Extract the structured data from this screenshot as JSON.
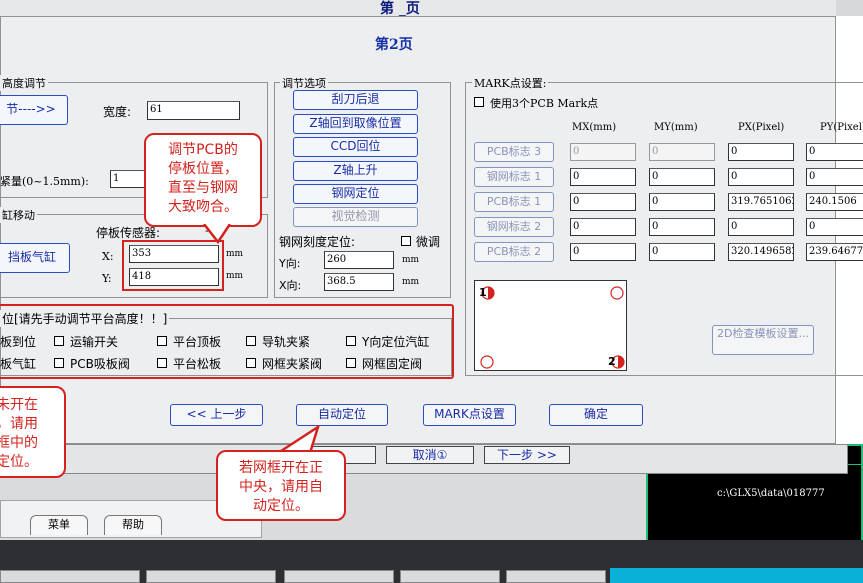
{
  "background": {
    "title_behind": "第 _页",
    "dialog_buttons": [
      "⊗",
      "取消①",
      "下一步 >>"
    ],
    "tabs": [
      "菜单",
      "帮助"
    ],
    "path_text": "c:\\GLX5\\data\\018777"
  },
  "dialog": {
    "title": "第2页",
    "height_group": {
      "label": "高度调节",
      "button_label": "节---->>",
      "width_label": "宽度:",
      "width_value": "61",
      "squeeze_label": "紧量(0~1.5mm):",
      "squeeze_value": "1"
    },
    "cylinder_group": {
      "label": "缸移动",
      "sensor_label": "停板传感器:",
      "sensor_dash": "--",
      "button_label": "挡板气缸",
      "x_label": "X:",
      "x_value": "353",
      "y_label": "Y:",
      "y_value": "418",
      "unit": "mm"
    },
    "adjust_group": {
      "label": "调节选项",
      "buttons": [
        "刮刀后退",
        "Z轴回到取像位置",
        "CCD回位",
        "Z轴上升",
        "钢网定位",
        "视觉检测"
      ],
      "stencil_label": "钢网刻度定位:",
      "fine_label": "微调",
      "y_label": "Y向:",
      "y_value": "260",
      "x_label": "X向:",
      "x_value": "368.5",
      "unit": "mm"
    },
    "mark_group": {
      "label": "MARK点设置:",
      "use3_label": "使用3个PCB  Mark点",
      "headers": [
        "MX(mm)",
        "MY(mm)",
        "PX(Pixel)",
        "PY(Pixel)"
      ],
      "rows": [
        {
          "button": "PCB标志 3",
          "mx": "0",
          "my": "0",
          "px": "0",
          "py": "0",
          "enabled": false
        },
        {
          "button": "钢网标志 1",
          "mx": "0",
          "my": "0",
          "px": "0",
          "py": "0",
          "enabled": true
        },
        {
          "button": "PCB标志 1",
          "mx": "0",
          "my": "0",
          "px": "319.7651062",
          "py": "240.1506",
          "enabled": true
        },
        {
          "button": "钢网标志 2",
          "mx": "0",
          "my": "0",
          "px": "0",
          "py": "0",
          "enabled": true
        },
        {
          "button": "PCB标志 2",
          "mx": "0",
          "my": "0",
          "px": "320.1496582",
          "py": "239.646774",
          "enabled": true
        }
      ],
      "mark1": "1",
      "mark2": "2",
      "check_button": "2D检查模板设置..."
    },
    "position_group": {
      "label": "位[请先手动调节平台高度！！]",
      "row1": [
        "板到位",
        "运输开关",
        "平台顶板",
        "导轨夹紧",
        "Y向定位汽缸"
      ],
      "row2": [
        "板气缸",
        "PCB吸板阀",
        "平台松板",
        "网框夹紧阀",
        "网框固定阀"
      ]
    },
    "footer_buttons": {
      "prev": "<< 上一步",
      "auto": "自动定位",
      "mark": "MARK点设置",
      "ok": "确定"
    }
  },
  "callouts": {
    "pcb": "调节PCB的停板位置，直至与钢网大致吻合。",
    "left": "未开在，请用框中的定位。",
    "center": "若网框开在正中央，请用自动定位。"
  },
  "callout_lines": {
    "pcb": [
      "调节PCB的",
      "停板位置，",
      "直至与钢网",
      "大致吻合。"
    ],
    "left": [
      "未开在",
      "，请用",
      "框中的",
      "定位。"
    ],
    "center": [
      "若网框开在正",
      "中央，请用自",
      "动定位。"
    ]
  },
  "colors": {
    "accent_red": "#d4231e",
    "button_text_blue": "#1a2ba6",
    "dialog_bg": "#eceef0"
  }
}
